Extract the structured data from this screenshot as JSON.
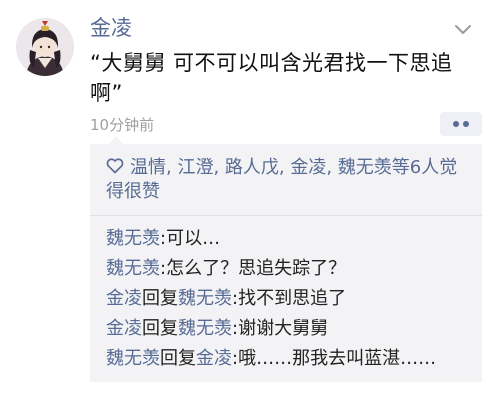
{
  "post": {
    "author": "金凌",
    "content": "“大舅舅 可不可以叫含光君找一下思追啊”",
    "time": "10分钟前"
  },
  "likes": {
    "text": "温情, 江澄, 路人戊, 金凌, 魏无羡等6人觉得很赞"
  },
  "comments": [
    {
      "from": "魏无羡",
      "reply_word": "",
      "to": "",
      "text": "可以…"
    },
    {
      "from": "魏无羡",
      "reply_word": "",
      "to": "",
      "text": "怎么了？思追失踪了？"
    },
    {
      "from": "金凌",
      "reply_word": "回复",
      "to": "魏无羡",
      "text": "找不到思追了"
    },
    {
      "from": "金凌",
      "reply_word": "回复",
      "to": "魏无羡",
      "text": "谢谢大舅舅"
    },
    {
      "from": "魏无羡",
      "reply_word": "回复",
      "to": "金凌",
      "text": "哦……那我去叫蓝湛……"
    }
  ],
  "colors": {
    "name_link": "#576b95",
    "panel_bg": "#f3f3f5",
    "timestamp": "#a0a0a0"
  },
  "icons": [
    "avatar",
    "chevron-down-icon",
    "more-options-icon",
    "heart-icon"
  ]
}
